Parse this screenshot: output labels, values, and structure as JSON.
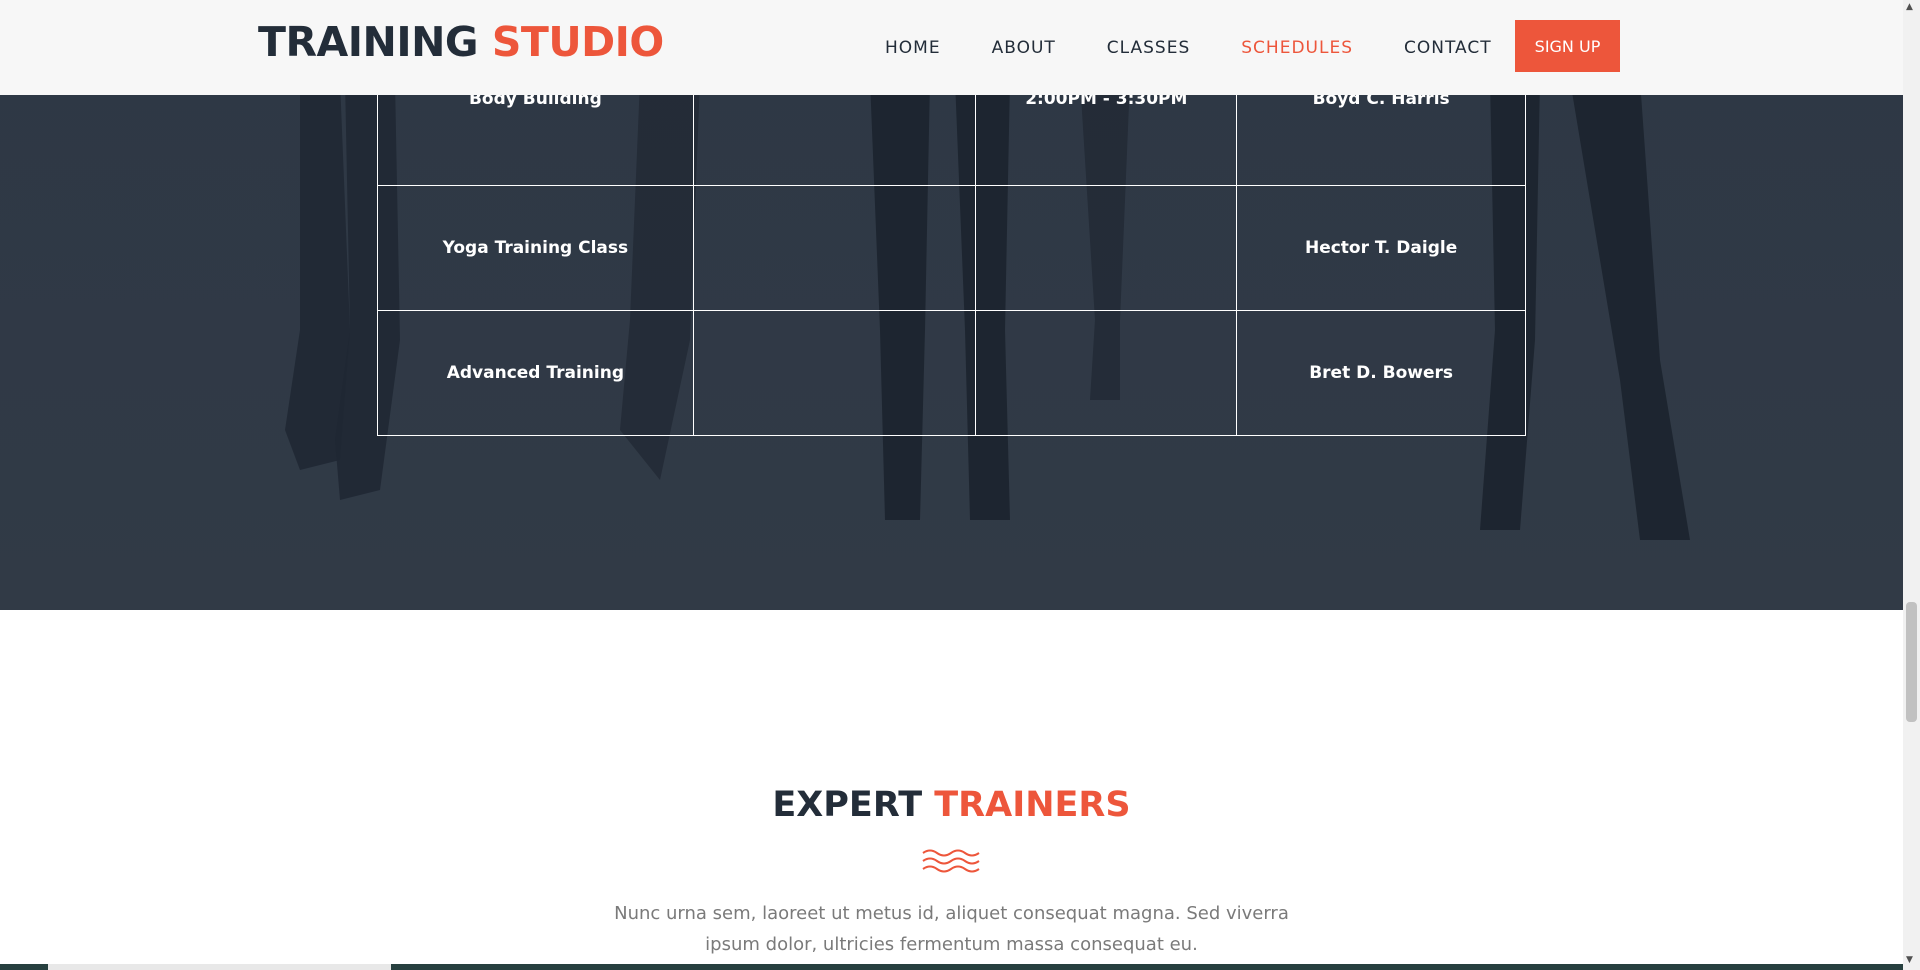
{
  "header": {
    "logo_part1": "TRAINING",
    "logo_part2": "STUDIO",
    "nav": [
      "HOME",
      "ABOUT",
      "CLASSES",
      "SCHEDULES",
      "CONTACT"
    ],
    "active_nav": "SCHEDULES",
    "signup_label": "SIGN UP"
  },
  "schedule": {
    "rows": [
      {
        "class": "Body Building",
        "col2": "",
        "time": "2:00PM - 3:30PM",
        "trainer": "Boyd C. Harris"
      },
      {
        "class": "Yoga Training Class",
        "col2": "",
        "time": "",
        "trainer": "Hector T. Daigle"
      },
      {
        "class": "Advanced Training",
        "col2": "",
        "time": "",
        "trainer": "Bret D. Bowers"
      }
    ]
  },
  "trainers": {
    "title_part1": "EXPERT",
    "title_part2": "TRAINERS",
    "desc_line1": "Nunc urna sem, laoreet ut metus id, aliquet consequat magna. Sed viverra",
    "desc_line2": "ipsum dolor, ultricies fermentum massa consequat eu."
  },
  "colors": {
    "accent": "#ed563b",
    "dark": "#232d39"
  }
}
